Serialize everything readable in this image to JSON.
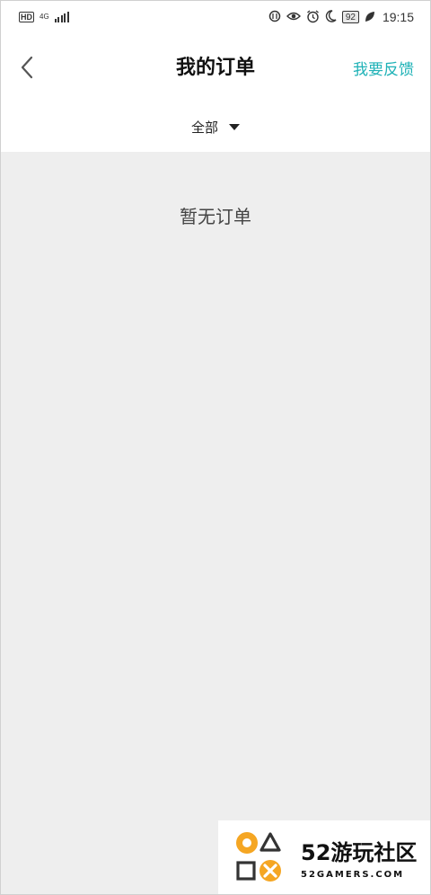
{
  "status_bar": {
    "hd": "HD",
    "network_type": "4G",
    "battery": "92",
    "time": "19:15",
    "icons": [
      "hd-icon",
      "4g-icon",
      "signal-icon",
      "nfc-icon",
      "eye-icon",
      "alarm-icon",
      "moon-icon",
      "battery-icon",
      "leaf-icon"
    ]
  },
  "header": {
    "title": "我的订单",
    "feedback_label": "我要反馈",
    "back_icon": "chevron-left-icon"
  },
  "filter": {
    "selected": "全部",
    "icon": "caret-down-icon"
  },
  "content": {
    "empty_message": "暂无订单"
  },
  "watermark": {
    "title": "52游玩社区",
    "subtitle": "52GAMERS.COM"
  },
  "colors": {
    "accent": "#1fb2b7",
    "background": "#eeeeee",
    "logo_orange": "#f5a623"
  }
}
